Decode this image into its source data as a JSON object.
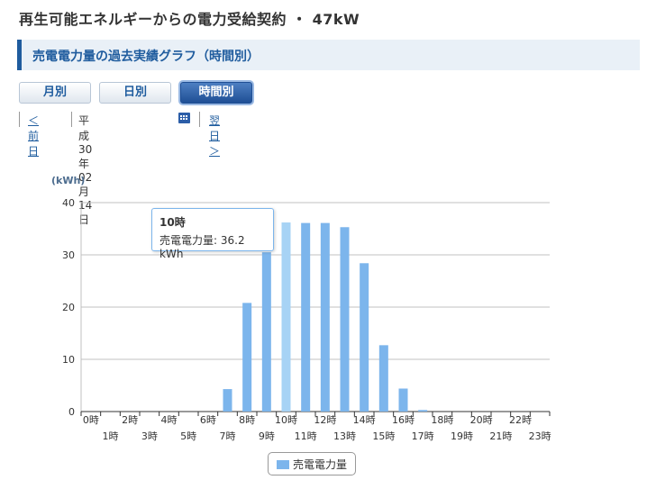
{
  "page": {
    "title": "再生可能エネルギーからの電力受給契約 ・ 47kW",
    "section_title": "売電電力量の過去実績グラフ（時間別）"
  },
  "tabs": [
    {
      "label": "月別",
      "active": false
    },
    {
      "label": "日別",
      "active": false
    },
    {
      "label": "時間別",
      "active": true
    }
  ],
  "date_nav": {
    "prev_label": "＜前日",
    "date": "平成30年02月14日",
    "next_label": "翌日＞",
    "calendar_icon": "calendar-icon"
  },
  "tooltip": {
    "title": "10時",
    "line": "売電電力量: 36.2 kWh"
  },
  "legend": {
    "label": "売電電力量"
  },
  "colors": {
    "bar": "#7cb5ec",
    "bar_highlight": "#a7d3f5",
    "accent": "#1f5c9e"
  },
  "chart_data": {
    "type": "bar",
    "ylabel": "(kWh)",
    "ylim": [
      0,
      40
    ],
    "yticks": [
      0,
      10,
      20,
      30,
      40
    ],
    "grid": true,
    "legend_position": "bottom-center",
    "categories": [
      "0時",
      "1時",
      "2時",
      "3時",
      "4時",
      "5時",
      "6時",
      "7時",
      "8時",
      "9時",
      "10時",
      "11時",
      "12時",
      "13時",
      "14時",
      "15時",
      "16時",
      "17時",
      "18時",
      "19時",
      "20時",
      "21時",
      "22時",
      "23時"
    ],
    "series": [
      {
        "name": "売電電力量",
        "values": [
          0,
          0,
          0,
          0,
          0,
          0,
          0,
          4.3,
          20.8,
          30.5,
          36.2,
          36.1,
          36.1,
          35.3,
          28.4,
          12.7,
          4.4,
          0.3,
          0,
          0,
          0,
          0,
          0,
          0
        ]
      }
    ],
    "highlight_index": 10
  }
}
